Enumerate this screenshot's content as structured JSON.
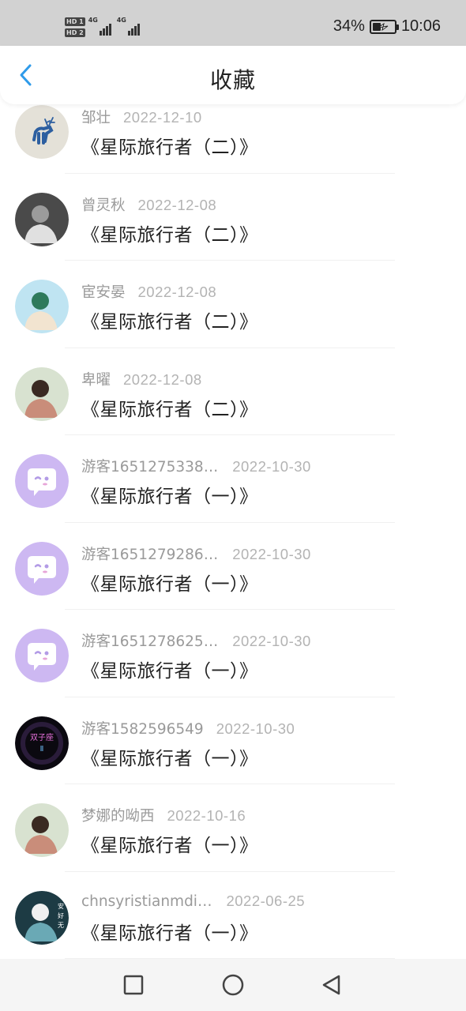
{
  "status": {
    "battery_percent": "34%",
    "time": "10:06",
    "sim1": "HD 1",
    "sim2": "HD 2",
    "network1": "4G",
    "network2": "4G",
    "battery_level": 0.34
  },
  "header": {
    "title": "收藏",
    "back_icon": "chevron-left-icon",
    "accent_color": "#2f9bea"
  },
  "favorites": [
    {
      "name": "邹壮",
      "date": "2022-12-10",
      "book": "《星际旅行者（二）》",
      "avatar": "deer-avatar"
    },
    {
      "name": "曾灵秋",
      "date": "2022-12-08",
      "book": "《星际旅行者（二）》",
      "avatar": "photo-avatar"
    },
    {
      "name": "宦安晏",
      "date": "2022-12-08",
      "book": "《星际旅行者（二）》",
      "avatar": "photo-avatar"
    },
    {
      "name": "卑曜",
      "date": "2022-12-08",
      "book": "《星际旅行者（二）》",
      "avatar": "photo-avatar"
    },
    {
      "name": "游客1651275338…",
      "date": "2022-10-30",
      "book": "《星际旅行者（一）》",
      "avatar": "chat-bubble-avatar"
    },
    {
      "name": "游客1651279286…",
      "date": "2022-10-30",
      "book": "《星际旅行者（一）》",
      "avatar": "chat-bubble-avatar"
    },
    {
      "name": "游客1651278625…",
      "date": "2022-10-30",
      "book": "《星际旅行者（一）》",
      "avatar": "chat-bubble-avatar"
    },
    {
      "name": "游客1582596549",
      "date": "2022-10-30",
      "book": "《星际旅行者（一）》",
      "avatar": "gemini-avatar",
      "avatar_text": "双子座\nⅡ"
    },
    {
      "name": "梦娜的呦西",
      "date": "2022-10-16",
      "book": "《星际旅行者（一）》",
      "avatar": "photo-avatar"
    },
    {
      "name": "chnsyristianmdi…",
      "date": "2022-06-25",
      "book": "《星际旅行者（一）》",
      "avatar": "photo-avatar",
      "avatar_text": "安好无念"
    }
  ],
  "nav": {
    "recent_icon": "square-icon",
    "home_icon": "circle-icon",
    "back_icon": "triangle-back-icon"
  }
}
